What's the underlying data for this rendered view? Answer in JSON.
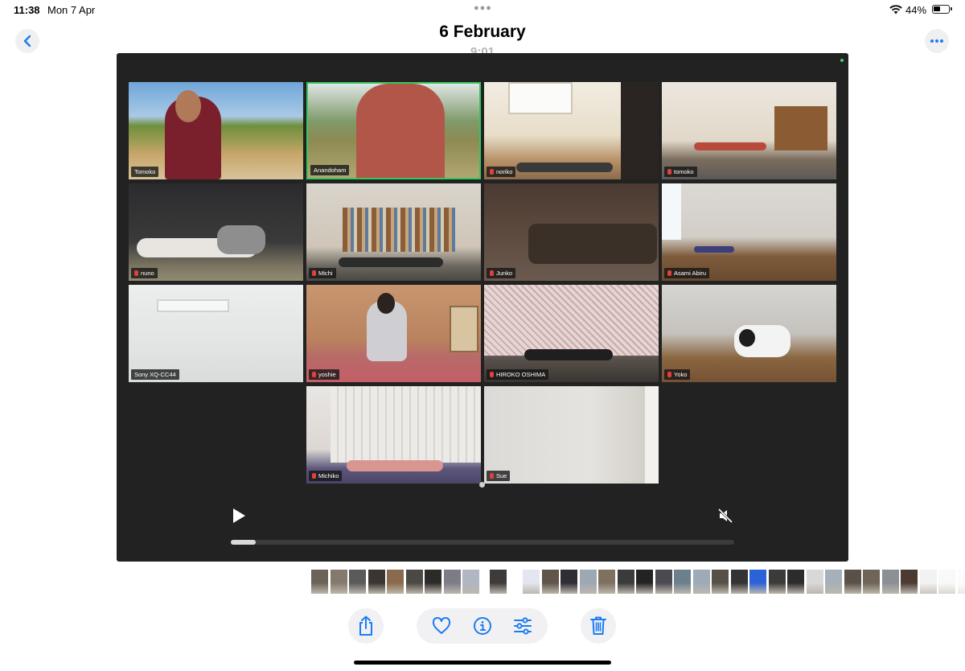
{
  "status_bar": {
    "time": "11:38",
    "date": "Mon 7 Apr",
    "battery": "44%"
  },
  "header": {
    "title": "6 February",
    "subtitle": "9:01"
  },
  "participants": [
    {
      "name": "Tomoko",
      "muted": false,
      "speaking": false
    },
    {
      "name": "Anandoham",
      "muted": false,
      "speaking": true
    },
    {
      "name": "noriko",
      "muted": true,
      "speaking": false
    },
    {
      "name": "tomoko",
      "muted": true,
      "speaking": false
    },
    {
      "name": "nuno",
      "muted": true,
      "speaking": false
    },
    {
      "name": "Michi",
      "muted": true,
      "speaking": false
    },
    {
      "name": "Junko",
      "muted": true,
      "speaking": false
    },
    {
      "name": "Asami Abiru",
      "muted": true,
      "speaking": false
    },
    {
      "name": "Sony XQ-CC44",
      "muted": false,
      "speaking": false
    },
    {
      "name": "yoshie",
      "muted": true,
      "speaking": false
    },
    {
      "name": "HIROKO OSHIMA",
      "muted": true,
      "speaking": false
    },
    {
      "name": "Yoko",
      "muted": true,
      "speaking": false
    },
    {
      "name": "Michiko",
      "muted": true,
      "speaking": false
    },
    {
      "name": "Sue",
      "muted": true,
      "speaking": false
    }
  ],
  "player": {
    "progress_percent": 5,
    "muted": true
  },
  "colors": {
    "accent": "#1b7cf2",
    "player_bg": "#222222",
    "speaking_border": "#35c85a",
    "mic_muted": "#e0413a"
  },
  "icons": {
    "back": "chevron-left-icon",
    "more": "ellipsis-icon",
    "share": "share-icon",
    "favorite": "heart-icon",
    "info": "info-icon",
    "adjust": "sliders-icon",
    "delete": "trash-icon",
    "play": "play-icon",
    "mute": "speaker-muted-icon"
  }
}
